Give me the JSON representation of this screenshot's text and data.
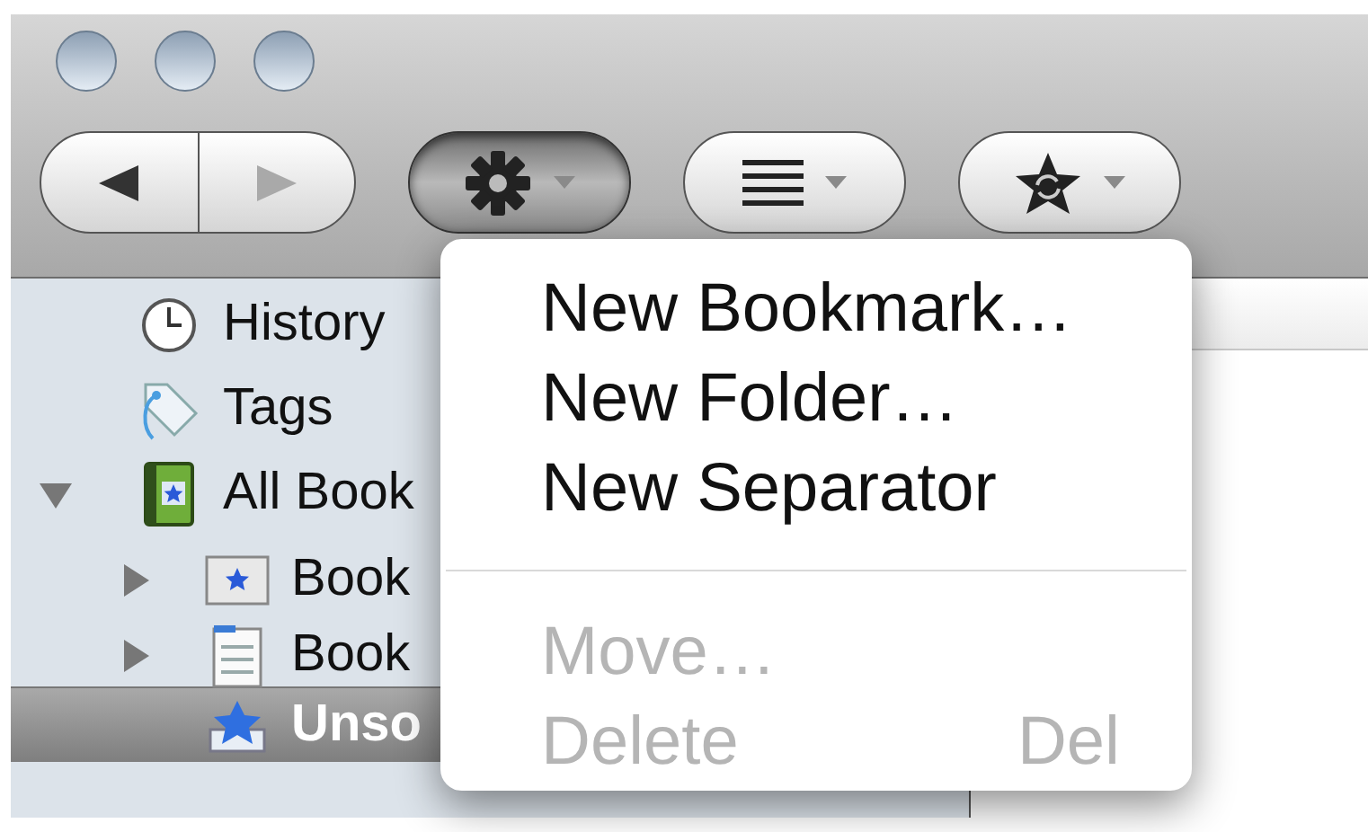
{
  "toolbar": {
    "navigation": [
      {
        "kind": "back",
        "disabled": false
      },
      {
        "kind": "forward",
        "disabled": true
      }
    ],
    "buttons": [
      {
        "kind": "organize",
        "pressed": true
      },
      {
        "kind": "views",
        "pressed": false
      },
      {
        "kind": "import",
        "pressed": false
      }
    ]
  },
  "sidebar": {
    "items": [
      {
        "kind": "history",
        "label": "History",
        "selected": false
      },
      {
        "kind": "tags",
        "label": "Tags",
        "selected": false
      },
      {
        "kind": "all",
        "label": "All Book",
        "selected": false,
        "expanded": true,
        "children": [
          {
            "kind": "toolbar",
            "label": "Book",
            "selected": false,
            "expanded": false
          },
          {
            "kind": "menu",
            "label": "Book",
            "selected": false,
            "expanded": false
          },
          {
            "kind": "unsorted",
            "label": "Unso",
            "selected": true
          }
        ]
      }
    ]
  },
  "menu": {
    "items": [
      {
        "kind": "item",
        "label": "New Bookmark…",
        "disabled": false
      },
      {
        "kind": "item",
        "label": "New Folder…",
        "disabled": false
      },
      {
        "kind": "item",
        "label": "New Separator",
        "disabled": false
      },
      {
        "kind": "separator"
      },
      {
        "kind": "item",
        "label": "Move…",
        "disabled": true
      },
      {
        "kind": "item",
        "label": "Delete",
        "disabled": true,
        "shortcut": "Del"
      }
    ]
  }
}
